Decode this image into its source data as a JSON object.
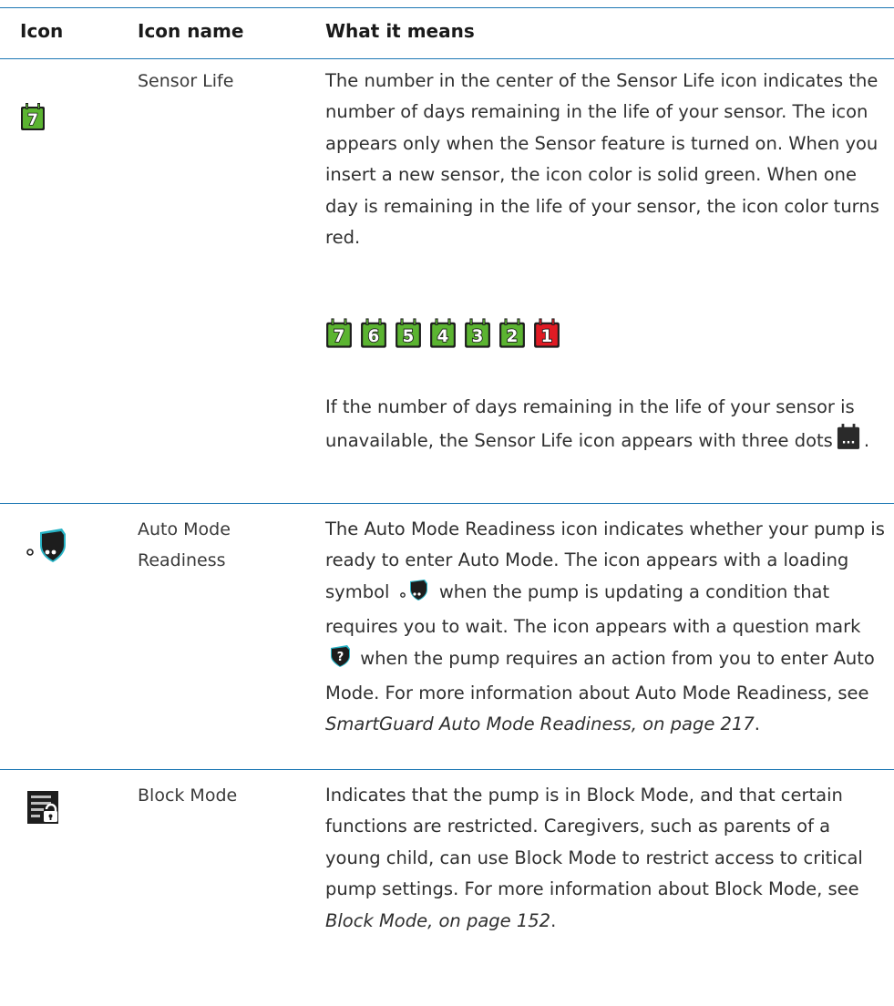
{
  "header": {
    "col_icon": "Icon",
    "col_name": "Icon name",
    "col_meaning": "What it means"
  },
  "rows": [
    {
      "name": "Sensor Life",
      "icon": "sensor-life-calendar-icon",
      "icon_number": "7",
      "desc1": "The number in the center of the Sensor Life icon indicates the number of days remaining in the life of your sensor. The icon appears only when the Sensor feature is turned on. When you insert a new sensor, the icon color is solid green. When one day is remaining in the life of your sensor, the icon color turns red.",
      "sequence": [
        "7",
        "6",
        "5",
        "4",
        "3",
        "2",
        "1"
      ],
      "desc2_before": "If the number of days remaining in the life of your sensor is unavailable, the Sensor Life icon appears with three dots",
      "desc2_after": ".",
      "unknown_icon_text": "..."
    },
    {
      "name": "Auto Mode Readiness",
      "icon": "auto-mode-readiness-shield-icon",
      "desc_a": "The Auto Mode Readiness icon indicates whether your pump is ready to enter Auto Mode. The icon appears with a loading symbol",
      "desc_b": "when the pump is updating a condition that requires you to wait. The icon appears with a question mark",
      "desc_c": "when the pump requires an action from you to enter Auto Mode. For more information about Auto Mode Readiness, see",
      "link": "SmartGuard Auto Mode Readiness, on page 217",
      "desc_end": "."
    },
    {
      "name": "Block Mode",
      "icon": "block-mode-lock-icon",
      "desc": "Indicates that the pump is in Block Mode, and that certain functions are restricted. Caregivers, such as parents of a young child, can use Block Mode to restrict access to critical pump settings. For more information about Block Mode, see",
      "link": "Block Mode, on page 152",
      "desc_end": "."
    }
  ],
  "colors": {
    "rule": "#1e78b4",
    "sensor_green": "#5bb431",
    "sensor_red": "#e01b24",
    "shield_teal": "#27b3c5",
    "icon_dark": "#1d1d1d"
  }
}
